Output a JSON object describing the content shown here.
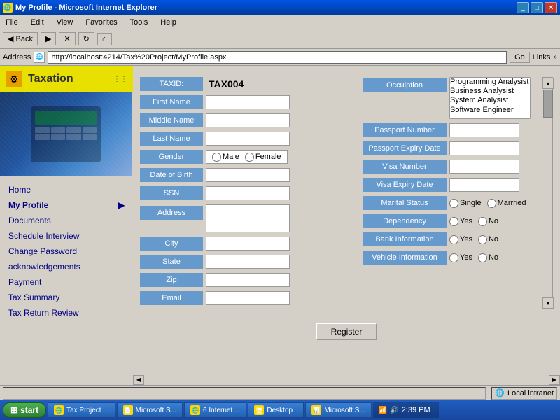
{
  "window": {
    "title": "My Profile - Microsoft Internet Explorer",
    "icon": "🌐"
  },
  "menubar": {
    "items": [
      "File",
      "Edit",
      "View",
      "Favorites",
      "Tools",
      "Help"
    ]
  },
  "addressbar": {
    "label": "Address",
    "url": "http://localhost:4214/Tax%20Project/MyProfile.aspx",
    "go_label": "Go",
    "links_label": "Links"
  },
  "sidebar": {
    "title": "Taxation",
    "nav_items": [
      {
        "label": "Home",
        "arrow": false
      },
      {
        "label": "My Profile",
        "arrow": true
      },
      {
        "label": "Documents",
        "arrow": false
      },
      {
        "label": "Schedule Interview",
        "arrow": false
      },
      {
        "label": "Change Password",
        "arrow": false
      },
      {
        "label": "acknowledgements",
        "arrow": false
      },
      {
        "label": "Payment",
        "arrow": false
      },
      {
        "label": "Tax Summary",
        "arrow": false
      },
      {
        "label": "Tax Return Review",
        "arrow": false
      }
    ]
  },
  "form": {
    "taxid_label": "TAXID:",
    "taxid_value": "TAX004",
    "first_name_label": "First Name",
    "middle_name_label": "Middle Name",
    "last_name_label": "Last Name",
    "gender_label": "Gender",
    "gender_options": [
      "Male",
      "Female"
    ],
    "dob_label": "Date of Birth",
    "ssn_label": "SSN",
    "address_label": "Address",
    "city_label": "City",
    "state_label": "State",
    "zip_label": "Zip",
    "email_label": "Email",
    "occupation_label": "Occuiption",
    "occupation_options": [
      "Programming Analysist",
      "Business Analysist",
      "System Analysist",
      "Software Engineer"
    ],
    "passport_number_label": "Passport Number",
    "passport_expiry_label": "Passport Expiry Date",
    "visa_number_label": "Visa Number",
    "visa_expiry_label": "Visa Expiry Date",
    "marital_status_label": "Marital Status",
    "marital_options": [
      "Single",
      "Marrried"
    ],
    "dependency_label": "Dependency",
    "dependency_options": [
      "Yes",
      "No"
    ],
    "bank_info_label": "Bank Information",
    "bank_options": [
      "Yes",
      "No"
    ],
    "vehicle_info_label": "Vehicle Information",
    "vehicle_options": [
      "Yes",
      "No"
    ],
    "register_button": "Register"
  },
  "statusbar": {
    "status": "Local intranet"
  },
  "taskbar": {
    "start_label": "start",
    "time": "2:39 PM",
    "buttons": [
      {
        "label": "Tax Project ...",
        "icon": "🌐"
      },
      {
        "label": "Microsoft S...",
        "icon": "📄"
      },
      {
        "label": "6 Internet ...",
        "icon": "🌐"
      },
      {
        "label": "Desktop",
        "icon": "🖥"
      },
      {
        "label": "Microsoft S...",
        "icon": "📊"
      }
    ]
  }
}
